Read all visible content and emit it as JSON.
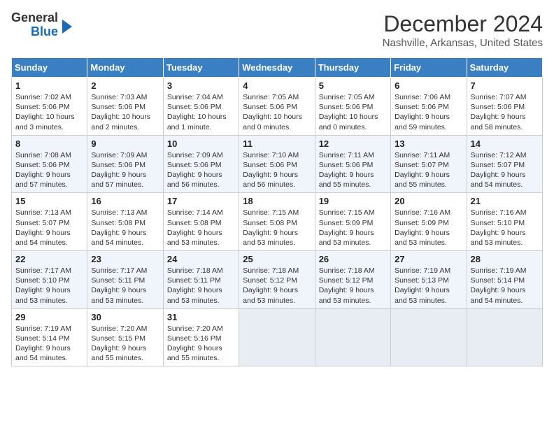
{
  "logo": {
    "line1": "General",
    "line2": "Blue"
  },
  "title": "December 2024",
  "subtitle": "Nashville, Arkansas, United States",
  "days_of_week": [
    "Sunday",
    "Monday",
    "Tuesday",
    "Wednesday",
    "Thursday",
    "Friday",
    "Saturday"
  ],
  "weeks": [
    [
      {
        "num": "1",
        "sunrise": "7:02 AM",
        "sunset": "5:06 PM",
        "daylight": "10 hours and 3 minutes."
      },
      {
        "num": "2",
        "sunrise": "7:03 AM",
        "sunset": "5:06 PM",
        "daylight": "10 hours and 2 minutes."
      },
      {
        "num": "3",
        "sunrise": "7:04 AM",
        "sunset": "5:06 PM",
        "daylight": "10 hours and 1 minute."
      },
      {
        "num": "4",
        "sunrise": "7:05 AM",
        "sunset": "5:06 PM",
        "daylight": "10 hours and 0 minutes."
      },
      {
        "num": "5",
        "sunrise": "7:05 AM",
        "sunset": "5:06 PM",
        "daylight": "10 hours and 0 minutes."
      },
      {
        "num": "6",
        "sunrise": "7:06 AM",
        "sunset": "5:06 PM",
        "daylight": "9 hours and 59 minutes."
      },
      {
        "num": "7",
        "sunrise": "7:07 AM",
        "sunset": "5:06 PM",
        "daylight": "9 hours and 58 minutes."
      }
    ],
    [
      {
        "num": "8",
        "sunrise": "7:08 AM",
        "sunset": "5:06 PM",
        "daylight": "9 hours and 57 minutes."
      },
      {
        "num": "9",
        "sunrise": "7:09 AM",
        "sunset": "5:06 PM",
        "daylight": "9 hours and 57 minutes."
      },
      {
        "num": "10",
        "sunrise": "7:09 AM",
        "sunset": "5:06 PM",
        "daylight": "9 hours and 56 minutes."
      },
      {
        "num": "11",
        "sunrise": "7:10 AM",
        "sunset": "5:06 PM",
        "daylight": "9 hours and 56 minutes."
      },
      {
        "num": "12",
        "sunrise": "7:11 AM",
        "sunset": "5:06 PM",
        "daylight": "9 hours and 55 minutes."
      },
      {
        "num": "13",
        "sunrise": "7:11 AM",
        "sunset": "5:07 PM",
        "daylight": "9 hours and 55 minutes."
      },
      {
        "num": "14",
        "sunrise": "7:12 AM",
        "sunset": "5:07 PM",
        "daylight": "9 hours and 54 minutes."
      }
    ],
    [
      {
        "num": "15",
        "sunrise": "7:13 AM",
        "sunset": "5:07 PM",
        "daylight": "9 hours and 54 minutes."
      },
      {
        "num": "16",
        "sunrise": "7:13 AM",
        "sunset": "5:08 PM",
        "daylight": "9 hours and 54 minutes."
      },
      {
        "num": "17",
        "sunrise": "7:14 AM",
        "sunset": "5:08 PM",
        "daylight": "9 hours and 53 minutes."
      },
      {
        "num": "18",
        "sunrise": "7:15 AM",
        "sunset": "5:08 PM",
        "daylight": "9 hours and 53 minutes."
      },
      {
        "num": "19",
        "sunrise": "7:15 AM",
        "sunset": "5:09 PM",
        "daylight": "9 hours and 53 minutes."
      },
      {
        "num": "20",
        "sunrise": "7:16 AM",
        "sunset": "5:09 PM",
        "daylight": "9 hours and 53 minutes."
      },
      {
        "num": "21",
        "sunrise": "7:16 AM",
        "sunset": "5:10 PM",
        "daylight": "9 hours and 53 minutes."
      }
    ],
    [
      {
        "num": "22",
        "sunrise": "7:17 AM",
        "sunset": "5:10 PM",
        "daylight": "9 hours and 53 minutes."
      },
      {
        "num": "23",
        "sunrise": "7:17 AM",
        "sunset": "5:11 PM",
        "daylight": "9 hours and 53 minutes."
      },
      {
        "num": "24",
        "sunrise": "7:18 AM",
        "sunset": "5:11 PM",
        "daylight": "9 hours and 53 minutes."
      },
      {
        "num": "25",
        "sunrise": "7:18 AM",
        "sunset": "5:12 PM",
        "daylight": "9 hours and 53 minutes."
      },
      {
        "num": "26",
        "sunrise": "7:18 AM",
        "sunset": "5:12 PM",
        "daylight": "9 hours and 53 minutes."
      },
      {
        "num": "27",
        "sunrise": "7:19 AM",
        "sunset": "5:13 PM",
        "daylight": "9 hours and 53 minutes."
      },
      {
        "num": "28",
        "sunrise": "7:19 AM",
        "sunset": "5:14 PM",
        "daylight": "9 hours and 54 minutes."
      }
    ],
    [
      {
        "num": "29",
        "sunrise": "7:19 AM",
        "sunset": "5:14 PM",
        "daylight": "9 hours and 54 minutes."
      },
      {
        "num": "30",
        "sunrise": "7:20 AM",
        "sunset": "5:15 PM",
        "daylight": "9 hours and 55 minutes."
      },
      {
        "num": "31",
        "sunrise": "7:20 AM",
        "sunset": "5:16 PM",
        "daylight": "9 hours and 55 minutes."
      },
      null,
      null,
      null,
      null
    ]
  ]
}
